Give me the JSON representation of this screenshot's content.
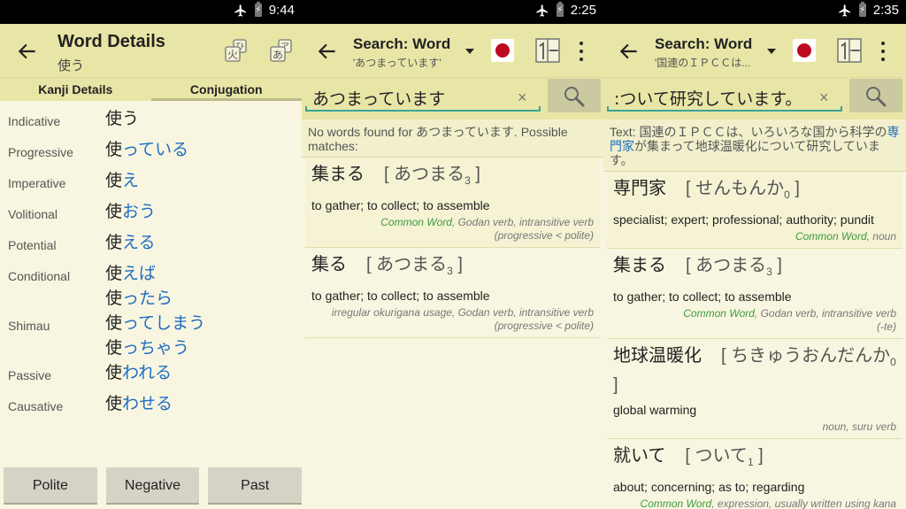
{
  "panel1": {
    "status": {
      "time": "9:44"
    },
    "appbar": {
      "title": "Word Details",
      "subtitle": "使う"
    },
    "tabs": [
      {
        "label": "Kanji Details",
        "active": false
      },
      {
        "label": "Conjugation",
        "active": true
      }
    ],
    "conjugations": [
      {
        "label": "Indicative",
        "forms": [
          {
            "stem": "使",
            "suffix": "う",
            "suffix_plain": true
          }
        ]
      },
      {
        "label": "Progressive",
        "forms": [
          {
            "stem": "使",
            "suffix": "っている"
          }
        ]
      },
      {
        "label": "Imperative",
        "forms": [
          {
            "stem": "使",
            "suffix": "え"
          }
        ]
      },
      {
        "label": "Volitional",
        "forms": [
          {
            "stem": "使",
            "suffix": "おう"
          }
        ]
      },
      {
        "label": "Potential",
        "forms": [
          {
            "stem": "使",
            "suffix": "える"
          }
        ]
      },
      {
        "label": "Conditional",
        "forms": [
          {
            "stem": "使",
            "suffix": "えば"
          },
          {
            "stem": "使",
            "suffix": "ったら"
          }
        ]
      },
      {
        "label": "Shimau",
        "forms": [
          {
            "stem": "使",
            "suffix": "ってしまう"
          },
          {
            "stem": "使",
            "suffix": "っちゃう"
          }
        ]
      },
      {
        "label": "Passive",
        "forms": [
          {
            "stem": "使",
            "suffix": "われる"
          }
        ]
      },
      {
        "label": "Causative",
        "forms": [
          {
            "stem": "使",
            "suffix": "わせる"
          }
        ]
      }
    ],
    "buttons": {
      "polite": "Polite",
      "negative": "Negative",
      "past": "Past"
    },
    "icons": {
      "kanji_icon_glyph": "火",
      "kanji_icon_small": "ひ",
      "kana_icon_glyph": "あ",
      "kana_icon_small": "ア"
    }
  },
  "panel2": {
    "status": {
      "time": "2:25"
    },
    "appbar": {
      "title": "Search: Word",
      "subtitle": "'あつまっています'"
    },
    "search": {
      "value": "あつまっています",
      "clear": "×"
    },
    "message": {
      "prefix": "No words found for ",
      "query": "あつまっています",
      "suffix": ". Possible matches:"
    },
    "entries": [
      {
        "word": "集まる",
        "reading": "あつまる",
        "sub": "3",
        "definition": "to gather; to collect; to assemble",
        "common": "Common Word",
        "tags": ", Godan verb, intransitive verb",
        "note": "(progressive < polite)"
      },
      {
        "word": "集る",
        "reading": "あつまる",
        "sub": "3",
        "definition": "to gather; to collect; to assemble",
        "common": "",
        "tags": "irregular okurigana usage, Godan verb, intransitive verb",
        "note": "(progressive < polite)"
      }
    ]
  },
  "panel3": {
    "status": {
      "time": "2:35"
    },
    "appbar": {
      "title": "Search: Word",
      "subtitle": "'国連のＩＰＣＣは..."
    },
    "search": {
      "value": ":ついて研究しています。",
      "clear": "×"
    },
    "message": {
      "prefix": "Text: 国連のＩＰＣＣは、いろいろな国から科学の",
      "highlight": "専門家",
      "suffix": "が集まって地球温暖化について研究しています。"
    },
    "entries": [
      {
        "word": "専門家",
        "reading": "せんもんか",
        "sub": "0",
        "definition": "specialist; expert; professional; authority; pundit",
        "common": "Common Word",
        "tags": ", noun",
        "note": ""
      },
      {
        "word": "集まる",
        "reading": "あつまる",
        "sub": "3",
        "definition": "to gather; to collect; to assemble",
        "common": "Common Word",
        "tags": ", Godan verb, intransitive verb",
        "note": "(-te)"
      },
      {
        "word": "地球温暖化",
        "reading": "ちきゅうおんだんか",
        "sub": "0",
        "definition": "global warming",
        "common": "",
        "tags": "noun, suru verb",
        "note": ""
      },
      {
        "word": "就いて",
        "reading": "ついて",
        "sub": "1",
        "definition": "about; concerning; as to; regarding",
        "common": "Common Word",
        "tags": ", expression, usually written using kana",
        "note": ""
      }
    ]
  },
  "colors": {
    "appbar": "#e8e6a6",
    "background": "#f8f6e0",
    "accent_blue": "#1e6cc4",
    "common_green": "#3f9a3f",
    "flag_red": "#bc0a1f"
  }
}
